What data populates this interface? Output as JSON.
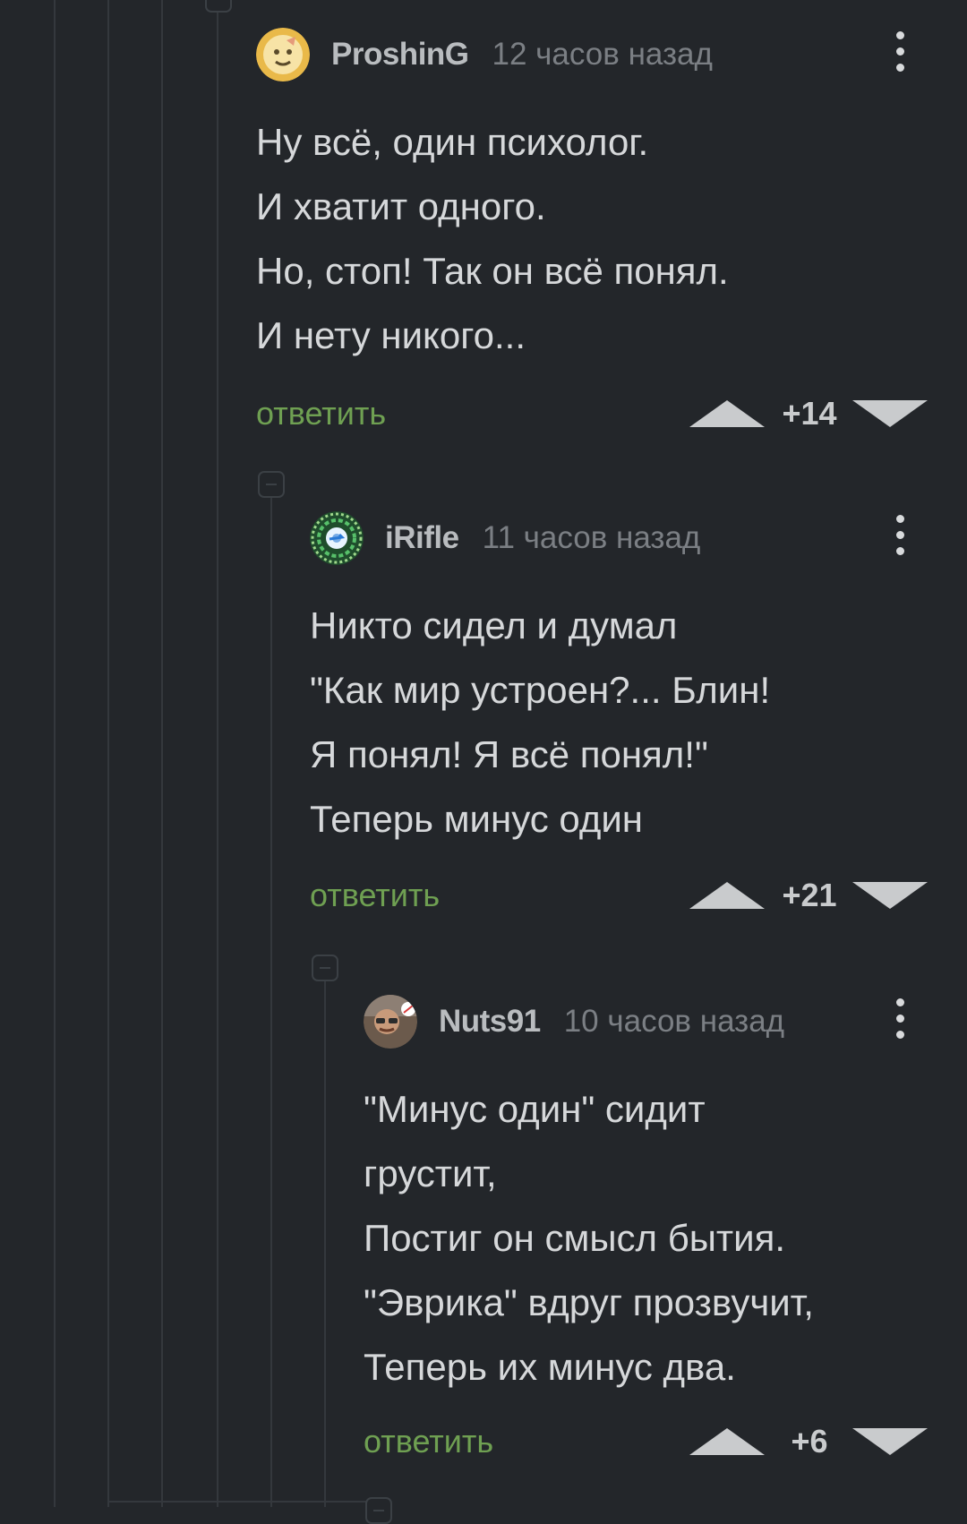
{
  "comments": [
    {
      "author": "ProshinG",
      "time": "12 часов назад",
      "lines": [
        "Ну всё, один психолог.",
        "И хватит одного.",
        "Но, стоп! Так он всё понял.",
        "И нету никого..."
      ],
      "reply_label": "ответить",
      "score": "+14",
      "avatar_icon": "emoji-face-avatar"
    },
    {
      "author": "iRifle",
      "time": "11 часов назад",
      "lines": [
        "Никто сидел и думал",
        "\"Как мир устроен?... Блин!",
        "Я понял! Я всё понял!\"",
        "Теперь минус один"
      ],
      "reply_label": "ответить",
      "score": "+21",
      "avatar_icon": "patterned-badge-avatar"
    },
    {
      "author": "Nuts91",
      "time": "10 часов назад",
      "lines": [
        "\"Минус один\" сидит",
        "грустит,",
        "Постиг он смысл бытия.",
        "\"Эврика\" вдруг прозвучит,",
        "Теперь их минус два."
      ],
      "reply_label": "ответить",
      "score": "+6",
      "avatar_icon": "photo-avatar"
    }
  ],
  "colors": {
    "background": "#23262a",
    "thread_line": "#34383d",
    "reply_link": "#6fa052",
    "author": "#b9bcbf",
    "time": "#7b7f84",
    "text": "#d6d8da"
  }
}
